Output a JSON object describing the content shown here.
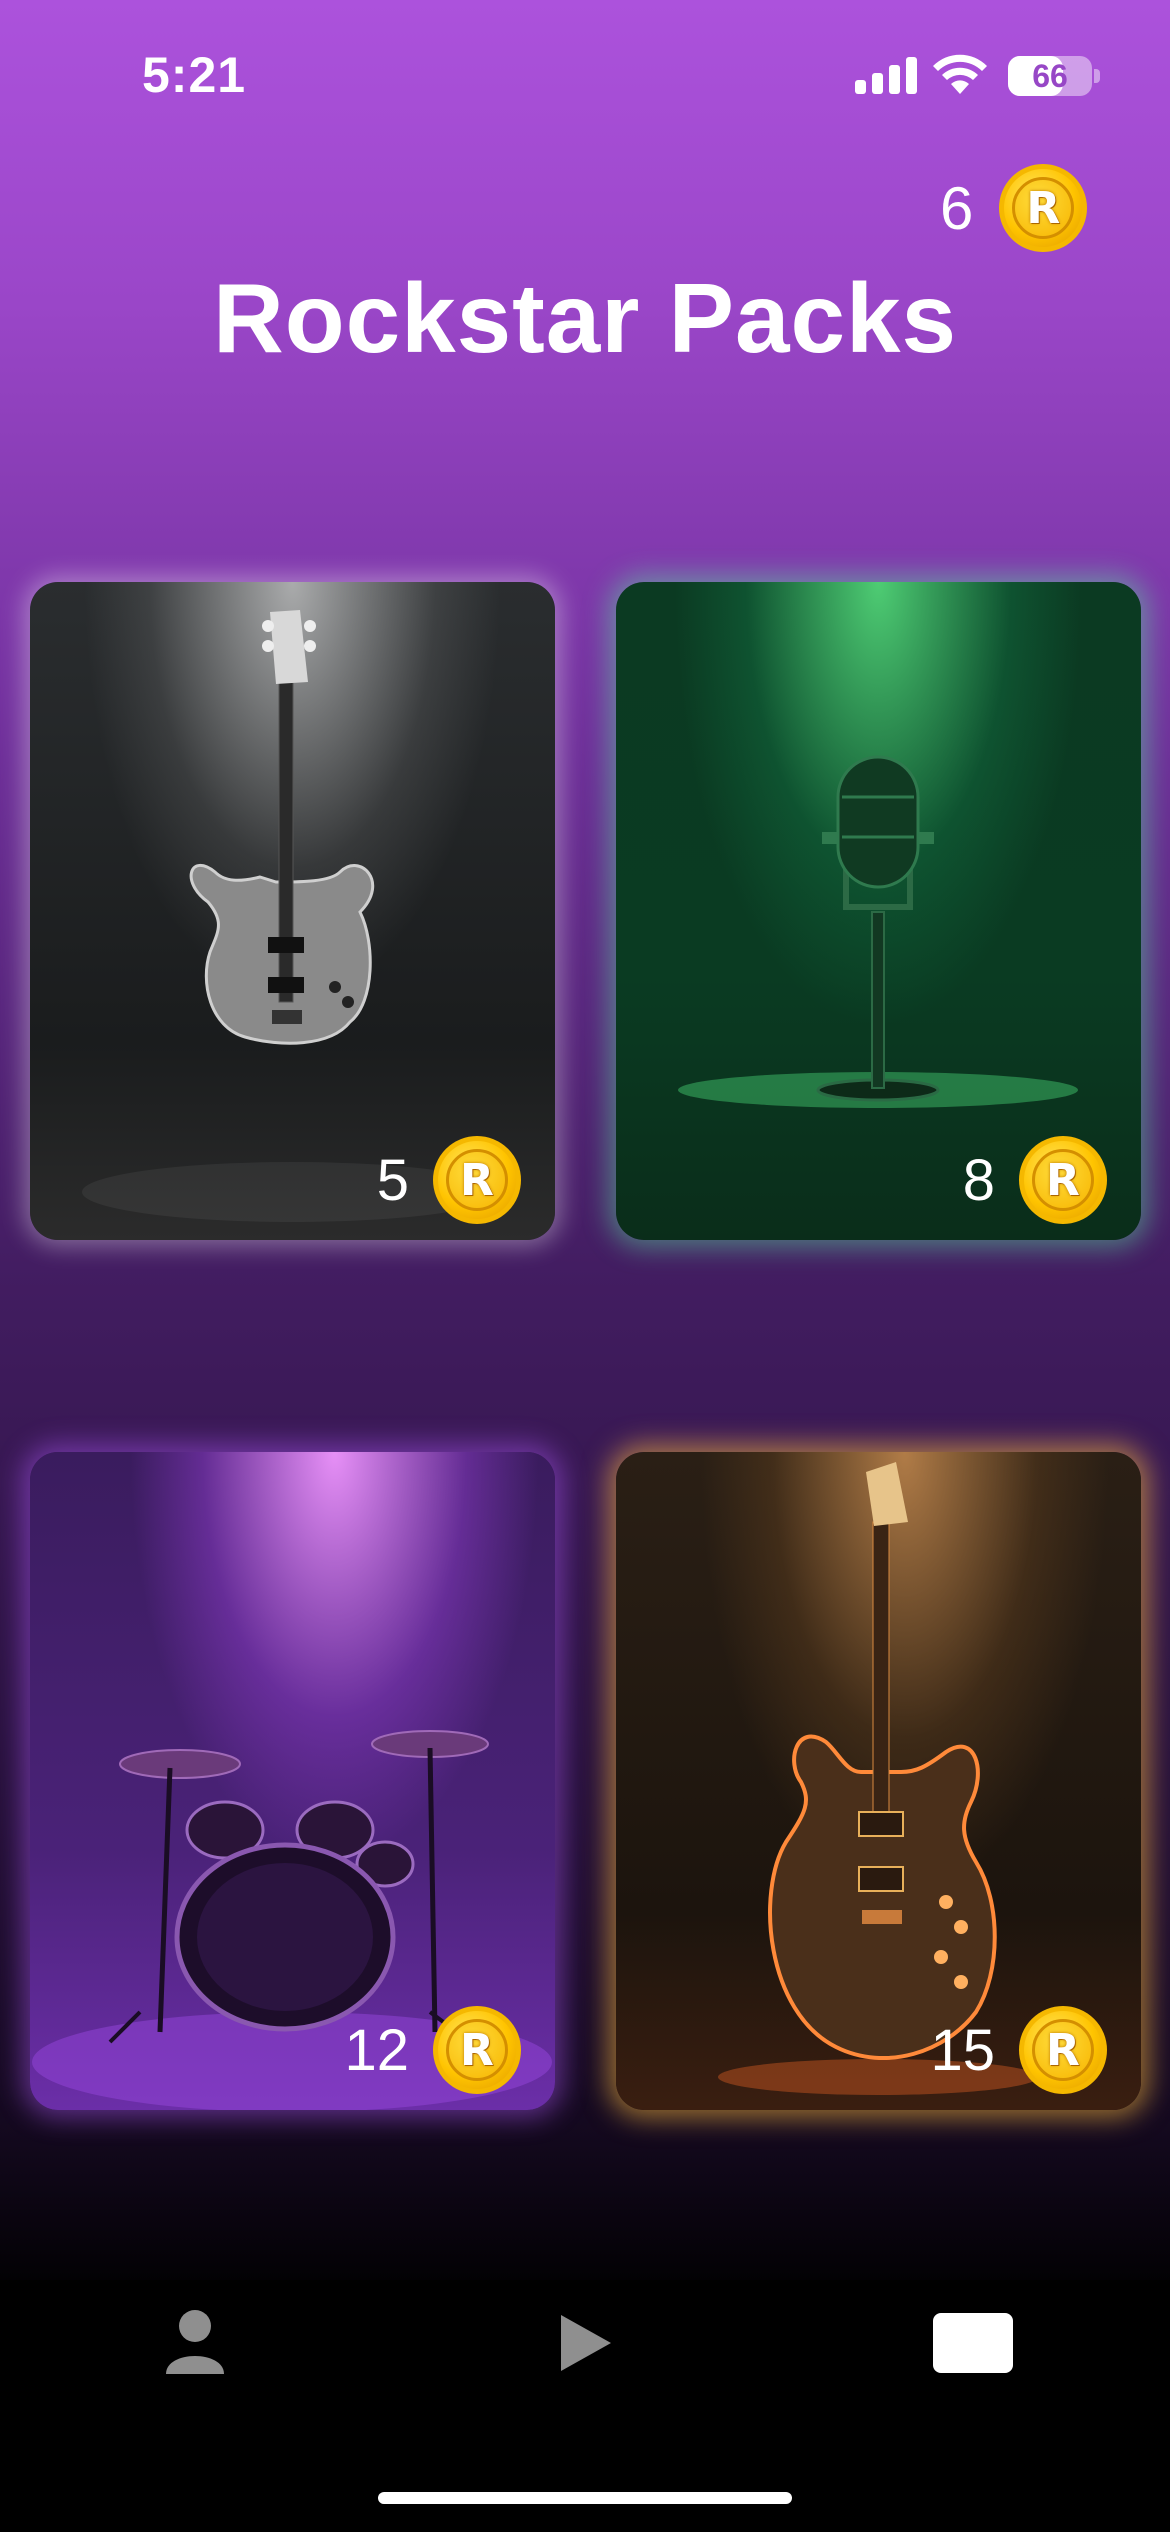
{
  "status_bar": {
    "time": "5:21",
    "battery": "66",
    "battery_level": 0.66
  },
  "header": {
    "coin_balance": "6",
    "coin_symbol": "R",
    "title": "Rockstar Packs"
  },
  "packs": [
    {
      "name": "bass",
      "price": "5",
      "coin_symbol": "R",
      "glow_color": "#ffffff",
      "icon": "bass-guitar"
    },
    {
      "name": "microphone",
      "price": "8",
      "coin_symbol": "R",
      "glow_color": "#5ae6a0",
      "icon": "microphone"
    },
    {
      "name": "drums",
      "price": "12",
      "coin_symbol": "R",
      "glow_color": "#b45aff",
      "icon": "drum-kit"
    },
    {
      "name": "electric-guitar",
      "price": "15",
      "coin_symbol": "R",
      "glow_color": "#ffbe3c",
      "icon": "electric-guitar"
    }
  ],
  "tab_bar": {
    "tabs": [
      {
        "icon": "profile-icon"
      },
      {
        "icon": "play-icon"
      },
      {
        "icon": "card-icon"
      }
    ],
    "selected_index": 2
  },
  "colors": {
    "accent": "#ac52dc",
    "coin": "#ffc400"
  }
}
